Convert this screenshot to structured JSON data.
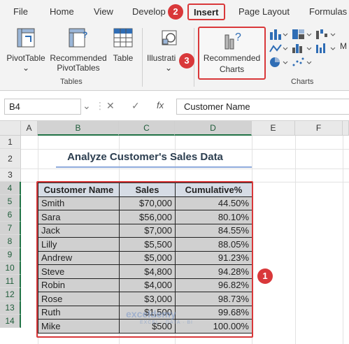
{
  "menu": {
    "file": "File",
    "home": "Home",
    "view": "View",
    "developer": "Develop",
    "insert": "Insert",
    "page_layout": "Page Layout",
    "formulas": "Formulas"
  },
  "ribbon": {
    "pivottable": "PivotTable",
    "recommended_pivottables_1": "Recommended",
    "recommended_pivottables_2": "PivotTables",
    "table": "Table",
    "illustrations": "Illustrati",
    "recommended_charts_1": "Recommended",
    "recommended_charts_2": "Charts",
    "group_tables": "Tables",
    "group_charts": "Charts"
  },
  "badges": {
    "b1": "1",
    "b2": "2",
    "b3": "3"
  },
  "formula_bar": {
    "name_box": "B4",
    "fx": "fx",
    "formula": "Customer Name"
  },
  "columns": [
    "A",
    "B",
    "C",
    "D",
    "E",
    "F"
  ],
  "rows": [
    "1",
    "2",
    "3",
    "4",
    "5",
    "6",
    "7",
    "8",
    "9",
    "10",
    "11",
    "12",
    "13",
    "14"
  ],
  "sheet": {
    "title": "Analyze Customer's Sales Data",
    "headers": [
      "Customer Name",
      "Sales",
      "Cumulative%"
    ],
    "data": [
      [
        "Smith",
        "$70,000",
        "44.50%"
      ],
      [
        "Sara",
        "$56,000",
        "80.10%"
      ],
      [
        "Jack",
        "$7,000",
        "84.55%"
      ],
      [
        "Lilly",
        "$5,500",
        "88.05%"
      ],
      [
        "Andrew",
        "$5,000",
        "91.23%"
      ],
      [
        "Steve",
        "$4,800",
        "94.28%"
      ],
      [
        "Robin",
        "$4,000",
        "96.82%"
      ],
      [
        "Rose",
        "$3,000",
        "98.73%"
      ],
      [
        "Ruth",
        "$1,500",
        "99.68%"
      ],
      [
        "Mike",
        "$500",
        "100.00%"
      ]
    ]
  },
  "watermark": {
    "brand": "exceldemy",
    "tagline": "EXCEL · DATA · BI"
  },
  "colors": {
    "accent_red": "#d9383a",
    "excel_green": "#217346",
    "header_fill": "#d6dce5",
    "cell_fill": "#d0d0d0"
  }
}
